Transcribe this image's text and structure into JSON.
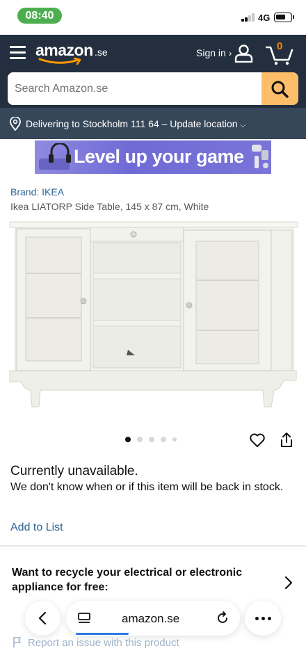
{
  "status_bar": {
    "time": "08:40",
    "network": "4G",
    "signal_bars_active": 2,
    "battery_level": 0.65
  },
  "header": {
    "logo_text": "amazon",
    "logo_suffix": ".se",
    "signin_label": "Sign in ›",
    "cart_count": "0",
    "search_placeholder": "Search Amazon.se",
    "icons": [
      "hamburger-icon",
      "user-icon",
      "cart-icon",
      "search-icon"
    ]
  },
  "delivery": {
    "text": "Delivering to Stockholm 111 64 – Update location",
    "chevron": "⌵"
  },
  "banner": {
    "text": "Level up your game"
  },
  "product": {
    "brand": "Brand: IKEA",
    "title": "Ikea LIATORP Side Table, 145 x 87 cm, White",
    "image_count": 5,
    "active_image_index": 0,
    "availability": "Currently unavailable.",
    "availability_detail": "We don't know when or if this item will be back in stock.",
    "add_to_list": "Add to List"
  },
  "recycle": {
    "text": "Want to recycle your electrical or electronic appliance for free:"
  },
  "footer": {
    "report_label": "Report an issue with this product"
  },
  "browser": {
    "url": "amazon.se",
    "icons": [
      "back-icon",
      "tabs-icon",
      "reload-icon",
      "more-icon"
    ]
  },
  "colors": {
    "header_bg": "#232f3e",
    "delivery_bg": "#37475a",
    "search_button": "#febd69",
    "link": "#2a6496",
    "cart_count": "#f08804",
    "time_pill": "#4cae4f"
  }
}
